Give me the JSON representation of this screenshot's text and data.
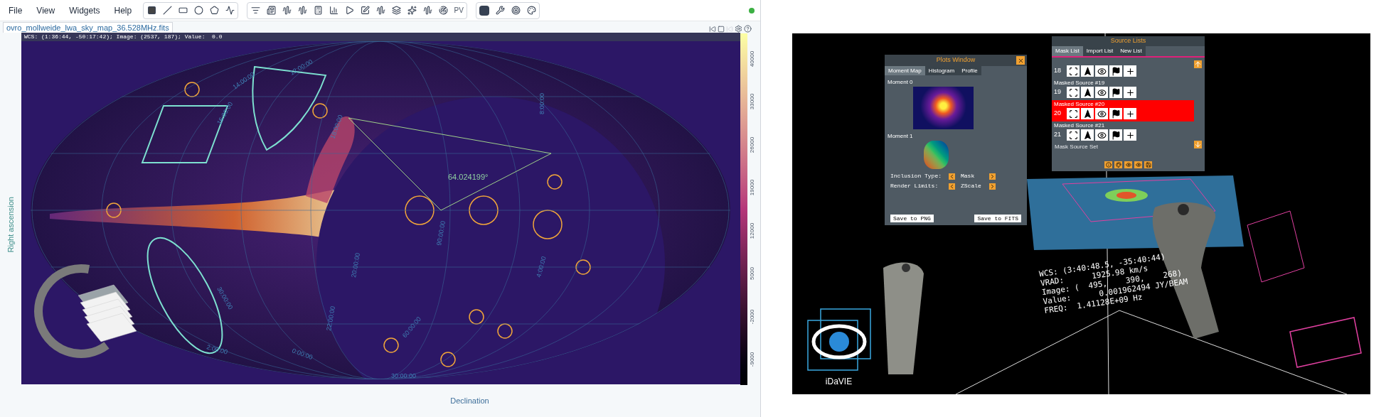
{
  "menu": [
    "File",
    "View",
    "Widgets",
    "Help"
  ],
  "toolbar": {
    "pv_label": "PV"
  },
  "image_tab": {
    "title": "ovro_mollweide_lwa_sky_map_36.528MHz.fits"
  },
  "cursor_info": "WCS: (1:36:44, -50:17:42); Image: (2537, 187); Value:  0.0",
  "grid_labels": [
    "14:00:00",
    "12:00:00",
    "16:00:00",
    "18:00:00",
    "20:00:00",
    "22:00:00",
    "0:00:00",
    "2:00:00",
    "30:00:00",
    "30:00:00",
    "90:00:00",
    "60:00:00",
    "8:00:00",
    "4:00:00"
  ],
  "measurement": "64.024199°",
  "axes": {
    "y_label": "Right ascension",
    "x_label": "Declination"
  },
  "colorbar": {
    "ticks": [
      "40000",
      "33000",
      "26000",
      "19000",
      "12000",
      "5000",
      "-2000",
      "-9000"
    ]
  },
  "vr": {
    "plots_window": {
      "title": "Plots Window",
      "tabs": [
        {
          "label": "Moment Map",
          "selected": true
        },
        {
          "label": "Histogram",
          "selected": false
        },
        {
          "label": "Profile",
          "selected": false
        }
      ],
      "moment0": "Moment 0",
      "moment1": "Moment 1",
      "options": [
        {
          "label": "Inclusion Type:",
          "value": "Mask"
        },
        {
          "label": "Render Limits:",
          "value": "ZScale"
        }
      ],
      "buttons": [
        "Save to PNG",
        "Save to FITS"
      ]
    },
    "source_lists": {
      "title": "Source Lists",
      "tabs": [
        {
          "label": "Mask List",
          "selected": true
        },
        {
          "label": "Import List",
          "selected": false
        },
        {
          "label": "New List",
          "selected": false
        }
      ],
      "rows": [
        {
          "label": "",
          "number": "18",
          "selected": false
        },
        {
          "label": "Masked Source #19",
          "number": "19",
          "selected": false
        },
        {
          "label": "Masked Source #20",
          "number": "20",
          "selected": true
        },
        {
          "label": "Masked Source #21",
          "number": "21",
          "selected": false
        }
      ],
      "footer": "Mask Source Set"
    },
    "readout": [
      "WCS: (3:40:48.5, -35:40:44)",
      "VRAD:      1925.98 km/s",
      "Image: (  495,    390,    268)",
      "Value:      0.001962494 JY/BEAM",
      "FREQ:  1.41128E+09 Hz"
    ],
    "logo_text": "iDaVIE"
  }
}
